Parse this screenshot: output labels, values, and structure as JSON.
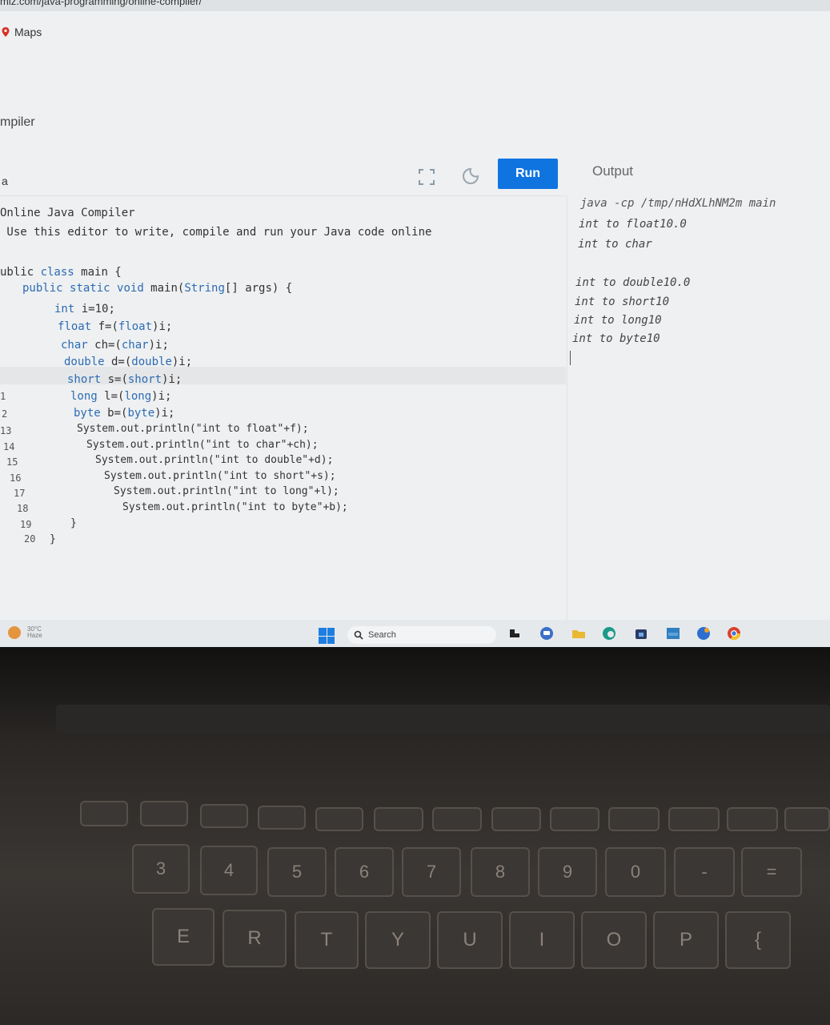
{
  "browser": {
    "url_fragment": "miz.com/java-programming/online-compiler/",
    "bookmark_maps": "Maps"
  },
  "page": {
    "title_partial": "mpiler",
    "tab_label": "a"
  },
  "toolbar": {
    "run_label": "Run",
    "output_label": "Output"
  },
  "editor": {
    "lines": [
      "Online Java Compiler",
      " Use this editor to write, compile and run your Java code online",
      "ublic class main {",
      "public static void main(String[] args) {",
      "int i=10;",
      "float f=(float)i;",
      "char ch=(char)i;",
      "double d=(double)i;",
      "short s=(short)i;",
      "long l=(long)i;",
      "byte b=(byte)i;",
      "System.out.println(\"int to float\"+f);",
      "System.out.println(\"int to char\"+ch);",
      "System.out.println(\"int to double\"+d);",
      "System.out.println(\"int to short\"+s);",
      "System.out.println(\"int to long\"+l);",
      "System.out.println(\"int to byte\"+b);",
      "}",
      "}"
    ],
    "line_numbers": [
      "1",
      "2",
      "13",
      "14",
      "15",
      "16",
      "17",
      "18",
      "19",
      "20"
    ]
  },
  "output": {
    "lines": [
      "java -cp /tmp/nHdXLhNM2m main",
      "int to float10.0",
      "int to char",
      "int to double10.0",
      "int to short10",
      "int to long10",
      "int to byte10"
    ]
  },
  "taskbar": {
    "weather_temp": "30°C",
    "weather_desc": "Haze",
    "search_label": "Search"
  },
  "keyboard": {
    "number_row": [
      "3",
      "4",
      "5",
      "6",
      "7",
      "8",
      "9",
      "0",
      "-",
      "="
    ],
    "letter_row": [
      "E",
      "R",
      "T",
      "Y",
      "U",
      "I",
      "O",
      "P",
      "{"
    ]
  },
  "colors": {
    "run_button": "#0f74e0",
    "keyword": "#2d6bb3",
    "screen_bg": "#eef0f1"
  }
}
